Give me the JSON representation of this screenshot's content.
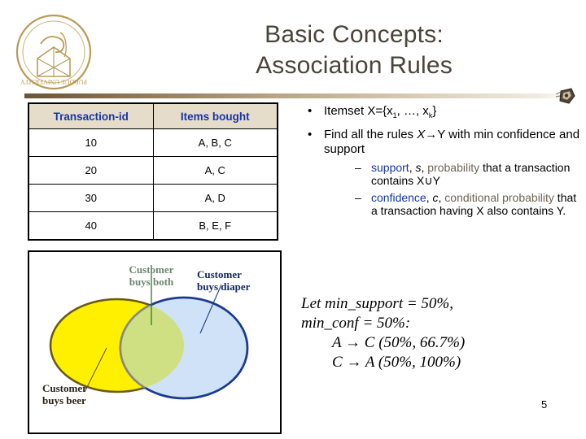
{
  "slide": {
    "title_lines": [
      "Basic Concepts:",
      "Association Rules"
    ],
    "page_number": "5",
    "logo_alt": "purdue-university-seal",
    "accent_color": "#6b5537",
    "header_text_color": "#1736a8",
    "keyword_blue": "#1736a8",
    "keyword_tan": "#6f6454"
  },
  "table": {
    "headers": [
      "Transaction-id",
      "Items bought"
    ],
    "rows": [
      {
        "id": "10",
        "items": "A, B, C"
      },
      {
        "id": "20",
        "items": "A, C"
      },
      {
        "id": "30",
        "items": "A, D"
      },
      {
        "id": "40",
        "items": "B, E, F"
      }
    ]
  },
  "bullets": {
    "marker": "•",
    "sub_marker": "–",
    "itemset": {
      "prefix": "Itemset X={x",
      "sub1": "1",
      "mid": ", …, x",
      "sub2": "k",
      "suffix": "}"
    },
    "find_rules": {
      "pre": "Find all the rules ",
      "var_x": "X",
      "arrow": "→",
      "var_y": "Y",
      "post": " with min confidence and support"
    },
    "support": {
      "keyword": "support",
      "sep1": ", ",
      "symbol": "s",
      "sep2": ", ",
      "tan": "probability",
      "tail": " that a transaction contains X",
      "union": "∪",
      "tail2": "Y"
    },
    "confidence": {
      "keyword": "confidence",
      "sep1": ", ",
      "symbol": "c",
      "sep2": ", ",
      "tan": "conditional probability",
      "tail": " that a transaction having X also contains Y."
    }
  },
  "example": {
    "line1": "Let  min_support = 50%,",
    "line2": "min_conf  = 50%:",
    "rule1_lhs": "A",
    "rule1_arrow": "→",
    "rule1_rhs": "C",
    "rule1_vals": "(50%, 66.7%)",
    "rule2_lhs": "C",
    "rule2_arrow": "→",
    "rule2_rhs": "A",
    "rule2_vals": "(50%, 100%)"
  },
  "venn": {
    "beer_label": [
      "Customer",
      "buys beer"
    ],
    "diaper_label": [
      "Customer",
      "buys diaper"
    ],
    "both_label": [
      "Customer",
      "buys both"
    ],
    "colors": {
      "beer_fill": "#FFF000",
      "beer_stroke": "#6b5a16",
      "diaper_fill": "#CFE2F7",
      "diaper_stroke": "#1b3c8e",
      "both_fill": "#CFE083",
      "both_stroke": "#8a8a8a",
      "leader_beer": "#6b5a16",
      "leader_diaper": "#1b3c8e",
      "leader_both": "#2a7a2a"
    }
  }
}
